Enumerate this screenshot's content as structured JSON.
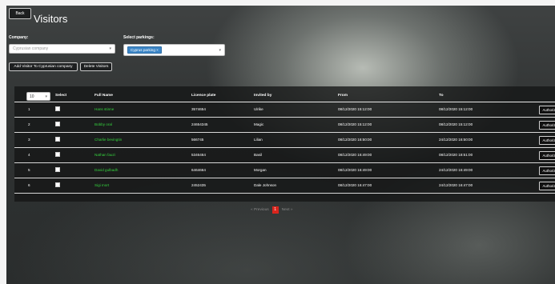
{
  "header": {
    "back_label": "Back",
    "title": "Visitors"
  },
  "filters": {
    "company_label": "Company:",
    "company_placeholder": "Cyprusian company",
    "parking_label": "Select parkings:",
    "parking_selected": "Cyprus parking ×"
  },
  "actions": {
    "add_visitor": "Add Visitor To Cyprusian company",
    "delete_visitors": "Delete Visitors"
  },
  "table": {
    "length_value": "10",
    "headers": {
      "select": "Select",
      "full_name": "Full Name",
      "license_plate": "Licence plate",
      "invited_by": "Invited by",
      "from": "From",
      "to": "To"
    },
    "rows": [
      {
        "id": "1",
        "name": "Hans stinne",
        "plate": "3574654",
        "invited": "Ulrike",
        "from": "08/12/2020 15:12:00",
        "to": "08/12/2020 15:12:00",
        "action": "Authorized"
      },
      {
        "id": "2",
        "name": "Bobby oral",
        "plate": "24654345",
        "invited": "Magic",
        "from": "08/12/2020 15:12:00",
        "to": "08/12/2020 15:12:00",
        "action": "Authorized"
      },
      {
        "id": "3",
        "name": "Charlie bevingtin",
        "plate": "566745",
        "invited": "Lilian",
        "from": "08/12/2020 16:50:00",
        "to": "24/12/2020 16:50:00",
        "action": "Authorized"
      },
      {
        "id": "4",
        "name": "Nathan fauzi",
        "plate": "5346464",
        "invited": "Basil",
        "from": "08/12/2020 16:49:00",
        "to": "08/12/2020 18:51:00",
        "action": "Authorized"
      },
      {
        "id": "5",
        "name": "David gulbadh",
        "plate": "6464664",
        "invited": "Morgan",
        "from": "08/12/2020 16:49:00",
        "to": "24/12/2020 16:49:00",
        "action": "Authorized"
      },
      {
        "id": "6",
        "name": "Sigi mort",
        "plate": "2452435",
        "invited": "Dale Johnson",
        "from": "08/12/2020 16:47:00",
        "to": "24/12/2020 16:47:00",
        "action": "Authorized"
      }
    ]
  },
  "pagination": {
    "previous": "« Previous",
    "current": "1",
    "next": "Next »"
  }
}
